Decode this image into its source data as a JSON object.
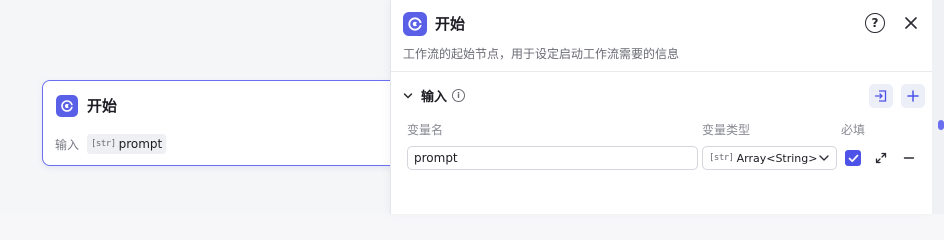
{
  "node": {
    "title": "开始",
    "input_label": "输入",
    "var_type_tag": "[str]",
    "var_name": "prompt"
  },
  "panel": {
    "title": "开始",
    "description": "工作流的起始节点，用于设定启动工作流需要的信息",
    "help_label": "?",
    "section": {
      "title": "输入",
      "info_label": "i"
    },
    "columns": {
      "name": "变量名",
      "type": "变量类型",
      "required": "必填"
    },
    "row": {
      "name": "prompt",
      "type_tag": "[str]",
      "type": "Array<String>",
      "required": true
    }
  },
  "colors": {
    "accent": "#4d53e8",
    "node_icon": "#5a5fe8",
    "node_border": "#6b70f0"
  }
}
